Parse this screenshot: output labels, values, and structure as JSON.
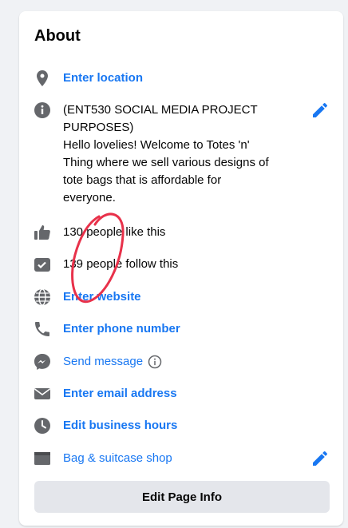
{
  "about": {
    "title": "About",
    "location": "Enter location",
    "description": "(ENT530 SOCIAL MEDIA PROJECT\nPURPOSES)\nHello lovelies! Welcome to Totes 'n'\nThing where we sell various designs of\ntote bags that is affordable for\neveryone.",
    "likes": "130 people like this",
    "follows": "139 people follow this",
    "website": "Enter website",
    "phone": "Enter phone number",
    "message": "Send message",
    "email": "Enter email address",
    "hours": "Edit business hours",
    "category": "Bag & suitcase shop",
    "edit_button": "Edit Page Info"
  },
  "colors": {
    "accent": "#1877f2",
    "icon": "#65676b",
    "annotation": "#e8314a"
  },
  "icons": {
    "location": "location-pin-icon",
    "info": "info-icon",
    "like": "thumbs-up-icon",
    "follow": "follow-check-icon",
    "website": "globe-icon",
    "phone": "phone-icon",
    "message": "messenger-icon",
    "email": "envelope-icon",
    "hours": "clock-icon",
    "category": "category-icon",
    "edit": "pencil-icon"
  }
}
